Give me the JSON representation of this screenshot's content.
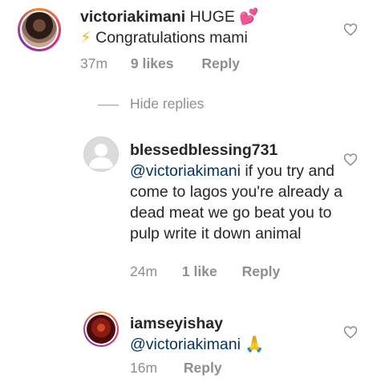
{
  "comments": [
    {
      "username": "victoriakimani",
      "text_line1": "HUGE",
      "emoji_hearts": "💕",
      "emoji_bolt": "⚡",
      "text_line2": "Congratulations mami",
      "time": "37m",
      "likes": "9 likes",
      "reply": "Reply"
    },
    {
      "username": "blessedblessing731",
      "mention": "@victoriakimani",
      "text": "if you try and come to lagos you're already a dead meat we go beat you to pulp write it down animal",
      "time": "24m",
      "likes": "1 like",
      "reply": "Reply"
    },
    {
      "username": "iamseyishay",
      "mention": "@victoriakimani",
      "emoji": "🙏",
      "time": "16m",
      "reply": "Reply"
    }
  ],
  "hide_replies": "Hide replies",
  "colors": {
    "text": "#262626",
    "secondary": "#8e8e8e",
    "mention": "#003569",
    "story_ring_start": "#f58529",
    "story_ring_end": "#dd2a7b"
  }
}
